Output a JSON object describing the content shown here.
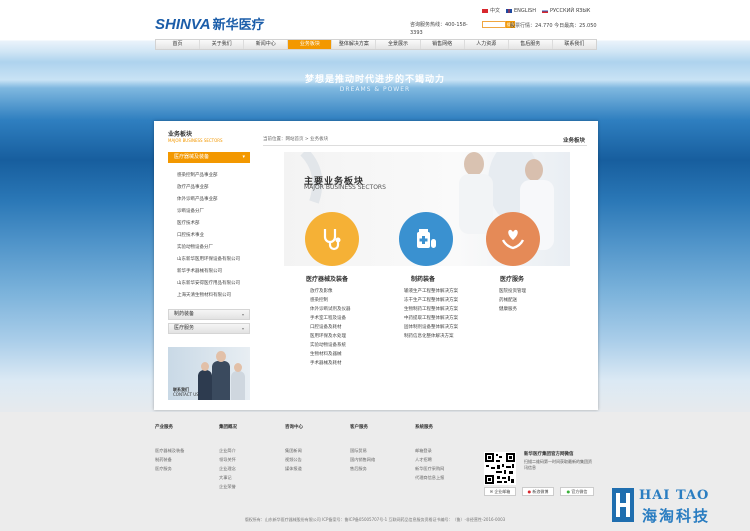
{
  "header": {
    "logo_en": "SHINVA",
    "logo_cn": "新华医疗",
    "languages": [
      {
        "label": "中文",
        "flag": "#d8272d"
      },
      {
        "label": "ENGLISH",
        "flag": "#1f4aa0"
      },
      {
        "label": "РУССКИЙ ЯЗЫК",
        "flag": "#2b56b0"
      }
    ],
    "hotline": "咨询服务热线：400-158-3393",
    "search_button": "搜索",
    "stock": "股票行情：24.770 今日最高：25.050"
  },
  "nav": {
    "items": [
      "首页",
      "关于我们",
      "新闻中心",
      "业务板块",
      "整体解决方案",
      "全景展示",
      "销售网络",
      "人力资源",
      "售后服务",
      "联系我们"
    ],
    "active_index": 3
  },
  "banner": {
    "slogan": "梦想是推动时代进步的不竭动力",
    "slogan_en": "DREAMS & POWER"
  },
  "sidebar": {
    "title": "业务板块",
    "subtitle": "MAJOR BUSINESS SECTORS",
    "active_header": "医疗器械及装备",
    "items": [
      "感染控制产品事业部",
      "放疗产品事业部",
      "体外诊断产品事业部",
      "诊断设备分厂",
      "医疗技术部",
      "口腔技术事业",
      "实验动物设备分厂",
      "山东新华医用环保设备有限公司",
      "新华手术器械有限公司",
      "山东新华安得医疗用品有限公司",
      "上海天清生物材料有限公司"
    ],
    "boxes": [
      "制药装备",
      "医疗服务"
    ],
    "contact_label": "联系我们",
    "contact_label_en": "CONTACT US"
  },
  "content": {
    "breadcrumb": "当前位置：网站首页 > 业务板块",
    "title": "业务板块",
    "hero_title": "主要业务板块",
    "hero_sub": "MAJOR BUSINESS SECTORS",
    "categories": [
      {
        "title": "医疗器械及装备",
        "color": "#f5b136",
        "icon": "stethoscope-icon",
        "items": [
          "放疗及影像",
          "感染控制",
          "体外诊断试剂及仪器",
          "手术室工程及设备",
          "口腔设备及耗材",
          "医用环保及水处理",
          "实验动物设备系统",
          "生物材料及器械",
          "手术器械及耗材"
        ]
      },
      {
        "title": "制药装备",
        "color": "#3a91d0",
        "icon": "medicine-icon",
        "items": [
          "输液生产工程整体解决方案",
          "冻干生产工程整体解决方案",
          "生物制药工程整体解决方案",
          "中药提取工程整体解决方案",
          "固体制剂设备整体解决方案",
          "制药信息化整体解决方案"
        ]
      },
      {
        "title": "医疗服务",
        "color": "#e58a57",
        "icon": "care-hands-icon",
        "items": [
          "医院投资管理",
          "药械配送",
          "健康服务"
        ]
      }
    ]
  },
  "footer": {
    "columns": [
      {
        "title": "产业服务",
        "items": [
          "医疗器械及装备",
          "制药装备",
          "医疗服务"
        ]
      },
      {
        "title": "集团概况",
        "items": [
          "企业简介",
          "领导关怀",
          "企业理念",
          "大事记",
          "企业荣誉"
        ]
      },
      {
        "title": "咨询中心",
        "items": [
          "集团新闻",
          "视频公告",
          "媒体报道"
        ]
      },
      {
        "title": "客户服务",
        "items": [
          "国际贸易",
          "国内销售网络",
          "售后服务"
        ]
      },
      {
        "title": "系统服务",
        "items": [
          "邮箱登录",
          "人才招聘",
          "新华医疗采购网",
          "代理商信息上报"
        ]
      }
    ],
    "wechat_title": "新华医疗集团官方网微信",
    "wechat_text": "扫描二维码第一时间获取最新的集团资讯信息",
    "buttons": [
      "企业邮箱",
      "新浪微博",
      "官方微信"
    ],
    "copyright": "版权所有：山东新华医疗器械股份有限公司    ICP备案号：鲁ICP备05005707号-1    互联网药品信息服务资格证书编号：（鲁）-非经营性-2016-0003"
  },
  "watermark": {
    "en": "HAI TAO",
    "cn": "海淘科技"
  }
}
